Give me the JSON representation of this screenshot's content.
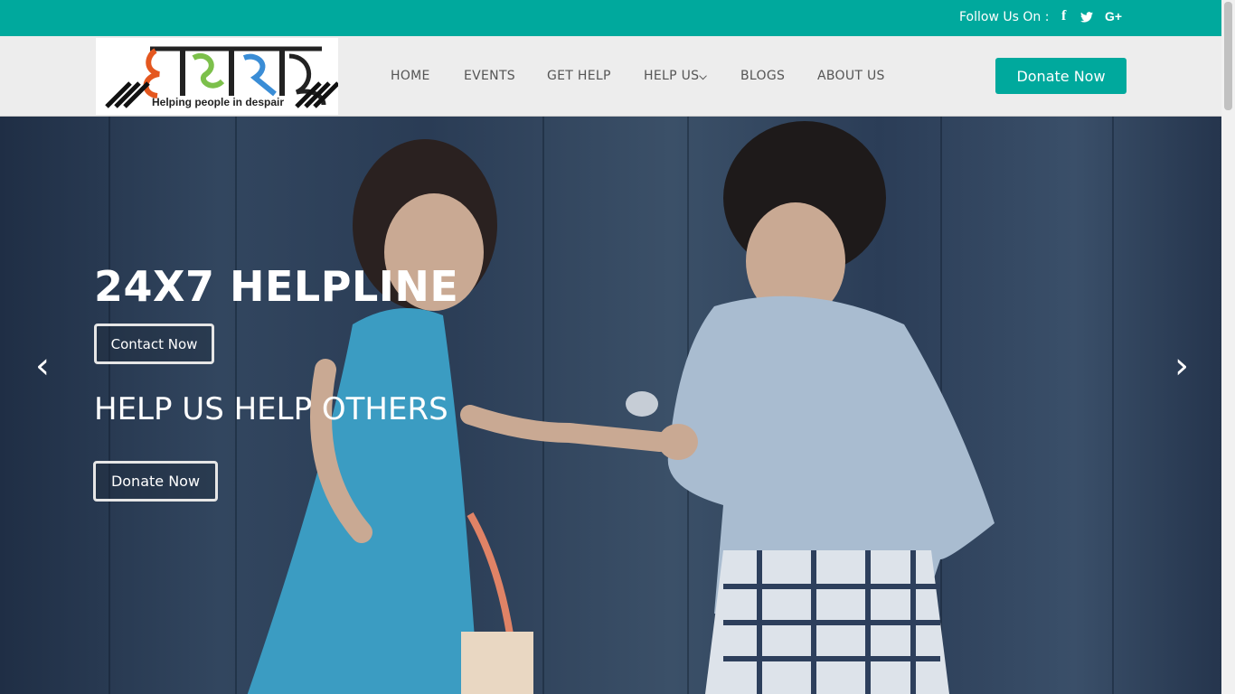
{
  "topbar": {
    "follow_label": "Follow Us On :",
    "social": [
      {
        "icon": "facebook-icon",
        "glyph": "f"
      },
      {
        "icon": "twitter-icon",
        "glyph": "🐦"
      },
      {
        "icon": "google-plus-icon",
        "glyph": "G+"
      }
    ]
  },
  "logo": {
    "text": "आसरा",
    "tagline": "Helping people in despair"
  },
  "nav": {
    "items": [
      "HOME",
      "EVENTS",
      "GET HELP",
      "HELP US",
      "BLOGS",
      "ABOUT US"
    ],
    "dropdown_caret": "⌄",
    "donate_label": "Donate Now"
  },
  "hero": {
    "title": "24X7 HELPLINE",
    "contact_label": "Contact Now",
    "subtitle": "HELP US HELP OTHERS",
    "donate_label": "Donate Now",
    "prev_glyph": "‹",
    "next_glyph": "›"
  },
  "colors": {
    "brand_teal": "#00a99d",
    "navbar_bg": "#ededed",
    "hero_dark": "#1f2e45"
  }
}
